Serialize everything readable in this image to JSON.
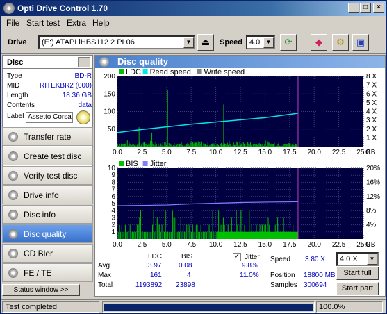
{
  "title": "Opti Drive Control 1.70",
  "menu": [
    "File",
    "Start test",
    "Extra",
    "Help"
  ],
  "toolbar": {
    "drive_label": "Drive",
    "drive_value": "(E:)   ATAPI iHBS112   2 PL06",
    "speed_label": "Speed",
    "speed_value": "4.0 X"
  },
  "disc_panel": {
    "header": "Disc",
    "type_k": "Type",
    "type_v": "BD-R",
    "mid_k": "MID",
    "mid_v": "RITEKBR2 (000)",
    "length_k": "Length",
    "length_v": "18.36 GB",
    "contents_k": "Contents",
    "contents_v": "data",
    "label_k": "Label",
    "label_v": "Assetto Corsa"
  },
  "nav": [
    {
      "label": "Transfer rate",
      "active": false
    },
    {
      "label": "Create test disc",
      "active": false
    },
    {
      "label": "Verify test disc",
      "active": false
    },
    {
      "label": "Drive info",
      "active": false
    },
    {
      "label": "Disc info",
      "active": false
    },
    {
      "label": "Disc quality",
      "active": true
    },
    {
      "label": "CD Bler",
      "active": false
    },
    {
      "label": "FE / TE",
      "active": false
    }
  ],
  "status_window_button": "Status window >>",
  "panel_title": "Disc quality",
  "chart_data": [
    {
      "type": "bar",
      "legend": [
        "LDC",
        "Read speed",
        "Write speed"
      ],
      "colors": {
        "LDC": "#00c000",
        "Read speed": "#00e8e8",
        "Write speed": "#808080"
      },
      "x_ticks": [
        "0.0",
        "2.5",
        "5.0",
        "7.5",
        "10.0",
        "12.5",
        "15.0",
        "17.5",
        "20.0",
        "22.5",
        "25.0"
      ],
      "x_unit": "GB",
      "xlim": [
        0,
        25
      ],
      "data_end_gb": 18.36,
      "y_left_ticks": [
        "50",
        "100",
        "150",
        "200"
      ],
      "ylim_left": [
        0,
        200
      ],
      "y_right_ticks": [
        "1 X",
        "2 X",
        "3 X",
        "4 X",
        "5 X",
        "6 X",
        "7 X",
        "8 X"
      ],
      "ylim_right": [
        0,
        8
      ],
      "ldc_typical_max": 15,
      "ldc_spikes": [
        {
          "x": 5.1,
          "y": 161
        },
        {
          "x": 10.8,
          "y": 120
        },
        {
          "x": 2.2,
          "y": 55
        },
        {
          "x": 3.5,
          "y": 40
        }
      ],
      "read_speed": {
        "x": [
          0,
          2.5,
          5,
          7.5,
          10,
          12.5,
          15,
          18.36
        ],
        "y": [
          1.6,
          1.95,
          2.25,
          2.55,
          2.8,
          3.05,
          3.3,
          3.8
        ]
      }
    },
    {
      "type": "bar",
      "legend": [
        "BIS",
        "Jitter"
      ],
      "colors": {
        "BIS": "#00c000",
        "Jitter": "#8080ff"
      },
      "x_ticks": [
        "0.0",
        "2.5",
        "5.0",
        "7.5",
        "10.0",
        "12.5",
        "15.0",
        "17.5",
        "20.0",
        "22.5",
        "25.0"
      ],
      "x_unit": "GB",
      "xlim": [
        0,
        25
      ],
      "y_left_ticks": [
        "1",
        "2",
        "3",
        "4",
        "5",
        "6",
        "7",
        "8",
        "9",
        "10"
      ],
      "ylim_left": [
        0,
        10
      ],
      "y_right_ticks": [
        "4%",
        "8%",
        "12%",
        "16%",
        "20%"
      ],
      "ylim_right": [
        0,
        20
      ],
      "bis_max": 4,
      "jitter": {
        "x": [
          0,
          2.5,
          5,
          7.5,
          10,
          12.5,
          15,
          18.36
        ],
        "y": [
          9.4,
          9.5,
          9.6,
          9.9,
          10.1,
          10.3,
          10.4,
          10.5
        ]
      }
    }
  ],
  "stats": {
    "col_ldc": "LDC",
    "col_bis": "BIS",
    "avg_label": "Avg",
    "avg_ldc": "3.97",
    "avg_bis": "0.08",
    "max_label": "Max",
    "max_ldc": "161",
    "max_bis": "4",
    "total_label": "Total",
    "total_ldc": "1193892",
    "total_bis": "23898",
    "jitter_label": "Jitter",
    "jitter_avg": "9.8%",
    "jitter_max": "11.0%",
    "speed_label": "Speed",
    "speed_value": "3.80 X",
    "speed_select": "4.0 X",
    "position_label": "Position",
    "position_value": "18800 MB",
    "samples_label": "Samples",
    "samples_value": "300694",
    "start_full": "Start full",
    "start_part": "Start part"
  },
  "statusbar": {
    "text": "Test completed",
    "progress": 1.0,
    "percent": "100.0%"
  }
}
